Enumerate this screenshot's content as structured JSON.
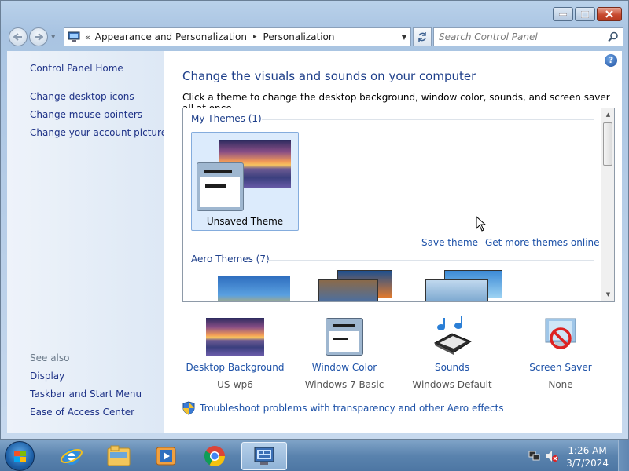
{
  "window": {
    "buttons": {
      "minimize": "minimize-icon",
      "maximize": "maximize-icon",
      "close": "close-icon"
    }
  },
  "address": {
    "breadcrumb": [
      "Appearance and Personalization",
      "Personalization"
    ],
    "separator": "▸"
  },
  "search": {
    "placeholder": "Search Control Panel"
  },
  "sidebar": {
    "home": "Control Panel Home",
    "links": [
      "Change desktop icons",
      "Change mouse pointers",
      "Change your account picture"
    ],
    "see_also_heading": "See also",
    "see_also": [
      "Display",
      "Taskbar and Start Menu",
      "Ease of Access Center"
    ]
  },
  "main": {
    "title": "Change the visuals and sounds on your computer",
    "subtitle": "Click a theme to change the desktop background, window color, sounds, and screen saver all at once.",
    "my_themes_title": "My Themes (1)",
    "unsaved_theme_label": "Unsaved Theme",
    "save_theme_link": "Save theme",
    "more_themes_link": "Get more themes online",
    "aero_themes_title": "Aero Themes (7)",
    "help_glyph": "?"
  },
  "settings": {
    "desktop_background": {
      "title": "Desktop Background",
      "value": "US-wp6"
    },
    "window_color": {
      "title": "Window Color",
      "value": "Windows 7 Basic"
    },
    "sounds": {
      "title": "Sounds",
      "value": "Windows Default"
    },
    "screen_saver": {
      "title": "Screen Saver",
      "value": "None"
    }
  },
  "troubleshoot_link": "Troubleshoot problems with transparency and other Aero effects",
  "taskbar": {
    "apps": [
      "internet-explorer-icon",
      "file-explorer-icon",
      "media-player-icon",
      "chrome-icon",
      "control-panel-icon"
    ],
    "time": "1:26 AM",
    "date": "3/7/2024"
  },
  "colors": {
    "link": "#1e52a8",
    "title": "#1e3f8a",
    "sidebar_link": "#1e3287",
    "selected_tile": "#dcebfc"
  }
}
